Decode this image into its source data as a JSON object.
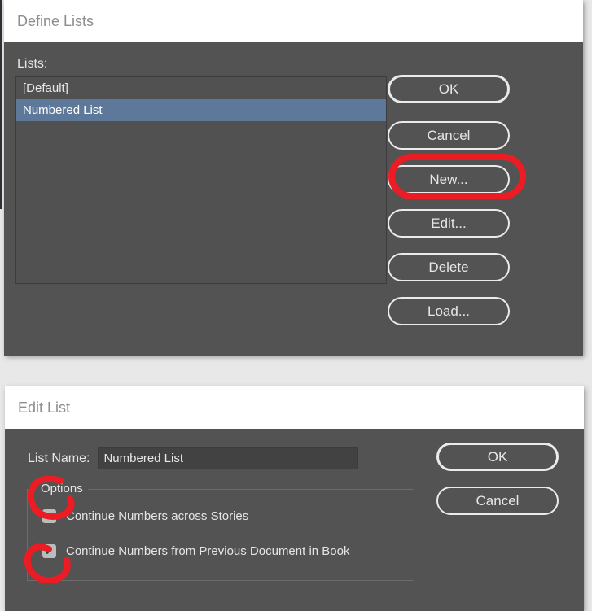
{
  "defineLists": {
    "title": "Define Lists",
    "listsLabel": "Lists:",
    "items": [
      "[Default]",
      "Numbered List"
    ],
    "selectedIndex": 1,
    "buttons": {
      "ok": "OK",
      "cancel": "Cancel",
      "new": "New...",
      "edit": "Edit...",
      "delete": "Delete",
      "load": "Load..."
    }
  },
  "editList": {
    "title": "Edit List",
    "nameLabel": "List Name:",
    "nameValue": "Numbered List",
    "optionsLegend": "Options",
    "opt1Label": "Continue Numbers across Stories",
    "opt1Checked": true,
    "opt2Label": "Continue Numbers from Previous Document in Book",
    "opt2Checked": true,
    "buttons": {
      "ok": "OK",
      "cancel": "Cancel"
    }
  },
  "annotations": {
    "newButtonCircled": true,
    "checkboxesCircled": true,
    "color": "#ec1c24"
  }
}
